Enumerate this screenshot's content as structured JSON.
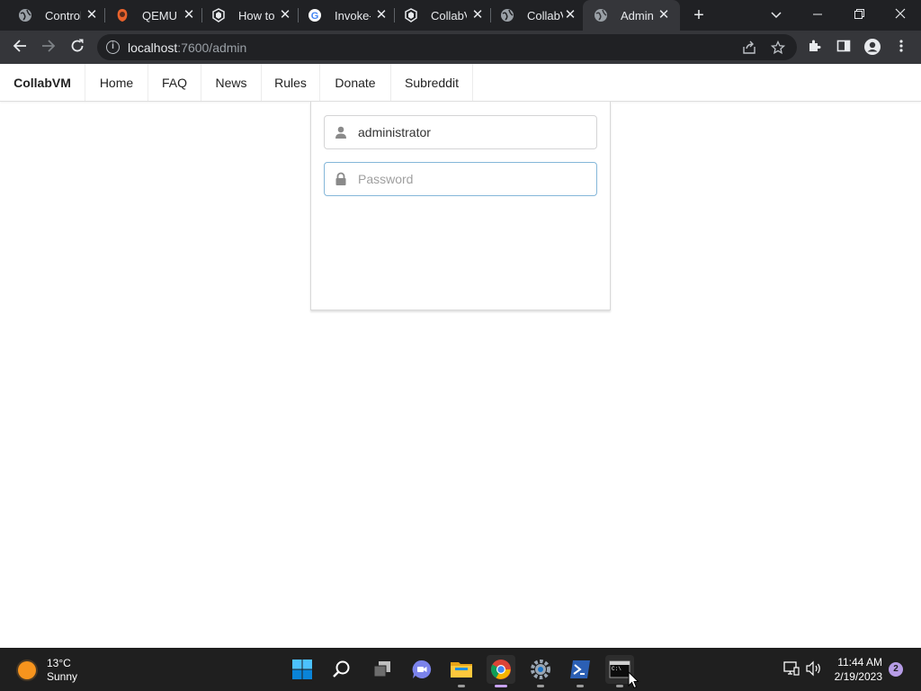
{
  "browser": {
    "tabs": [
      {
        "title": "Control",
        "icon": "globe-icon",
        "active": false
      },
      {
        "title": "QEMU f",
        "icon": "qemu-icon",
        "active": false
      },
      {
        "title": "How to",
        "icon": "collabvm-icon",
        "active": false
      },
      {
        "title": "Invoke-",
        "icon": "google-icon",
        "active": false
      },
      {
        "title": "CollabV",
        "icon": "collabvm-icon",
        "active": false
      },
      {
        "title": "CollabV",
        "icon": "globe-icon",
        "active": false
      },
      {
        "title": "Admin",
        "icon": "globe-icon",
        "active": true
      }
    ],
    "url_host": "localhost",
    "url_path": ":7600/admin"
  },
  "site_nav": {
    "brand": "CollabVM",
    "items": [
      "Home",
      "FAQ",
      "News",
      "Rules",
      "Donate",
      "Subreddit"
    ]
  },
  "login": {
    "username_value": "administrator",
    "password_placeholder": "Password"
  },
  "taskbar": {
    "weather_temp": "13°C",
    "weather_desc": "Sunny",
    "time": "11:44 AM",
    "date": "2/19/2023",
    "notification_count": "2"
  },
  "colors": {
    "tabstrip_bg": "#202124",
    "toolbar_bg": "#35363a",
    "focus_border": "#85b7d9",
    "taskbar_bg": "#1f1f1f"
  }
}
